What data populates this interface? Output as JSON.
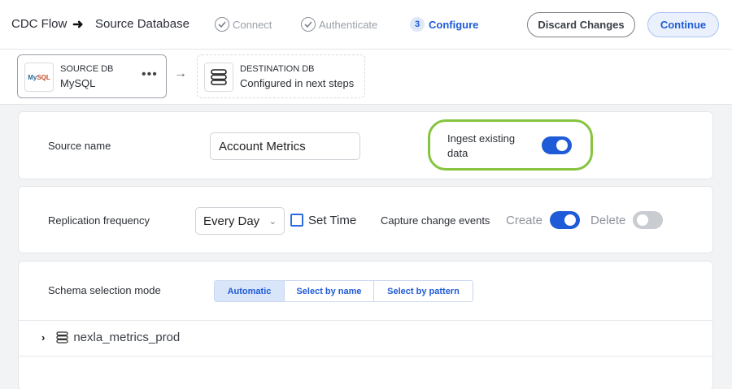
{
  "header": {
    "flow_title": "CDC Flow",
    "page_title": "Source Database",
    "steps": [
      {
        "label": "Connect",
        "state": "done"
      },
      {
        "label": "Authenticate",
        "state": "done"
      },
      {
        "number": "3",
        "label": "Configure",
        "state": "active"
      }
    ],
    "discard_label": "Discard Changes",
    "continue_label": "Continue"
  },
  "source_db": {
    "title": "SOURCE DB",
    "value": "MySQL",
    "logo_text_a": "My",
    "logo_text_b": "SQL",
    "menu": "•••"
  },
  "destination_db": {
    "title": "DESTINATION DB",
    "value": "Configured in next steps"
  },
  "source_panel": {
    "source_name_label": "Source name",
    "source_name_value": "Account Metrics",
    "ingest_label": "Ingest existing data",
    "ingest_enabled": true
  },
  "replication_panel": {
    "frequency_label": "Replication frequency",
    "frequency_value": "Every Day",
    "set_time_label": "Set Time",
    "set_time_checked": false,
    "capture_label": "Capture change events",
    "create_label": "Create",
    "create_enabled": true,
    "delete_label": "Delete",
    "delete_enabled": false
  },
  "schema_panel": {
    "mode_label": "Schema selection mode",
    "modes": [
      "Automatic",
      "Select by name",
      "Select by pattern"
    ],
    "selected_mode": "Automatic",
    "schemas": [
      {
        "name": "nexla_metrics_prod",
        "expanded": false
      }
    ]
  },
  "colors": {
    "accent": "#1f5bd6",
    "highlight": "#86c440"
  }
}
